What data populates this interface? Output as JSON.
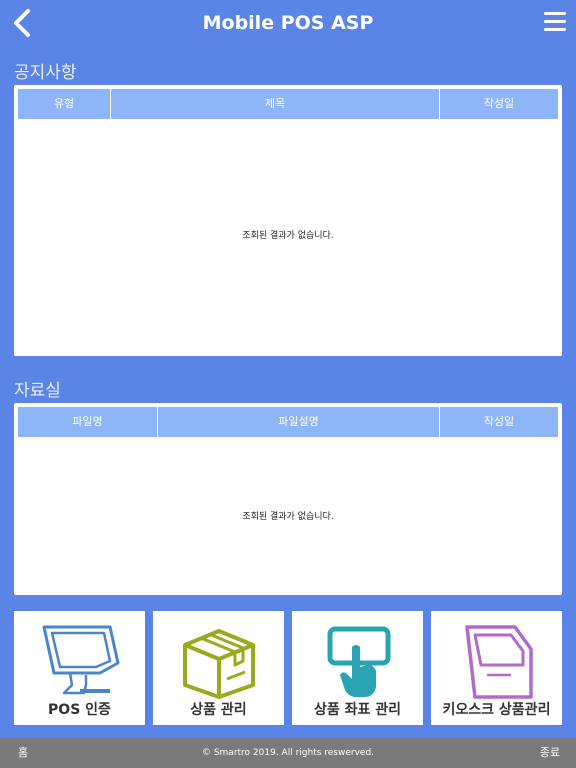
{
  "header": {
    "title": "Mobile POS ASP"
  },
  "notice": {
    "section_title": "공지사항",
    "columns": [
      "유형",
      "제목",
      "작성일"
    ],
    "empty_message": "조회된 결과가 없습니다."
  },
  "archive": {
    "section_title": "자료실",
    "columns": [
      "파일명",
      "파일설명",
      "작성일"
    ],
    "empty_message": "조회된 결과가 없습니다."
  },
  "menu": {
    "pos_auth": "POS 인증",
    "product_manage": "상품 관리",
    "product_coord_manage": "상품 좌표 관리",
    "kiosk_product_manage": "키오스크 상품관리"
  },
  "footer": {
    "home": "홈",
    "copyright": "© Smartro 2019. All rights reswerved.",
    "exit": "종료"
  },
  "colors": {
    "background": "#5a84e6",
    "table_header": "#8eb5f7",
    "pos_icon": "#4a86c8",
    "box_icon": "#9aaa1e",
    "touch_icon": "#2aa3b3",
    "kiosk_icon": "#b06ac8"
  }
}
